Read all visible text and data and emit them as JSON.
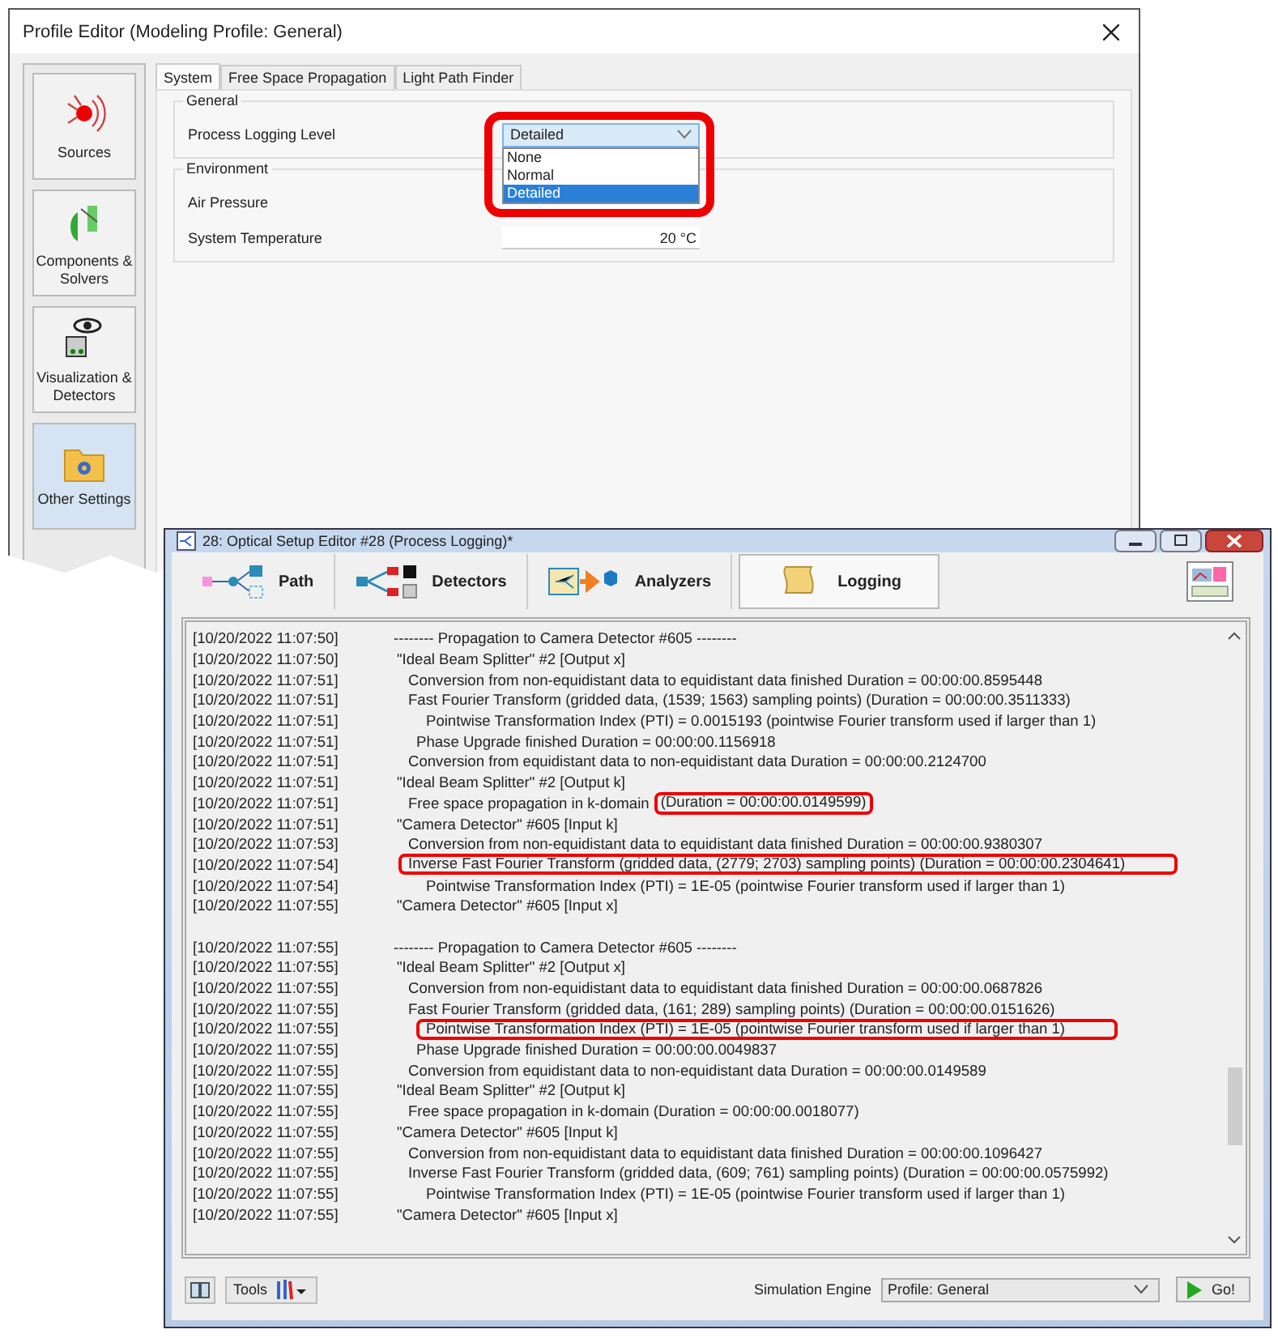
{
  "profile_editor": {
    "title": "Profile Editor (Modeling Profile: General)",
    "categories": [
      {
        "label": "Sources",
        "kind": "sources",
        "selected": false
      },
      {
        "label": "Components & Solvers",
        "kind": "components",
        "selected": false
      },
      {
        "label": "Visualization & Detectors",
        "kind": "visualization",
        "selected": false
      },
      {
        "label": "Other Settings",
        "kind": "settings",
        "selected": true
      }
    ],
    "tabs": [
      {
        "label": "System",
        "selected": true
      },
      {
        "label": "Free Space Propagation",
        "selected": false
      },
      {
        "label": "Light Path Finder",
        "selected": false
      }
    ],
    "groups": [
      {
        "title": "General",
        "fields": [
          {
            "label": "Process Logging Level",
            "kind": "dropdown",
            "value": "Detailed",
            "open": true,
            "highlighted": true,
            "options": [
              {
                "label": "None",
                "selected": false
              },
              {
                "label": "Normal",
                "selected": false
              },
              {
                "label": "Detailed",
                "selected": true
              }
            ]
          }
        ]
      },
      {
        "title": "Environment",
        "fields": [
          {
            "label": "Air Pressure",
            "kind": "number"
          },
          {
            "label": "System Temperature",
            "kind": "number",
            "value": "20 °C"
          }
        ]
      }
    ]
  },
  "setup_editor": {
    "title": "28: Optical Setup Editor #28 (Process Logging)*",
    "tabs": [
      {
        "label": "Path",
        "kind": "path",
        "selected": false
      },
      {
        "label": "Detectors",
        "kind": "detectors",
        "selected": false
      },
      {
        "label": "Analyzers",
        "kind": "analyzers",
        "selected": false
      },
      {
        "label": "Logging",
        "kind": "logging",
        "selected": true
      }
    ],
    "log": {
      "groups": [
        {
          "lines": [
            {
              "time": "[10/20/2022 11:07:50]",
              "kind": "section",
              "text": "-------- Propagation to Camera Detector #605 --------"
            },
            {
              "time": "[10/20/2022 11:07:50]",
              "kind": "element",
              "text": "\"Ideal Beam Splitter\" #2 [Output x]"
            },
            {
              "time": "[10/20/2022 11:07:51]",
              "kind": "step",
              "text": "Conversion from non-equidistant data to equidistant data finished Duration = 00:00:00.8595448"
            },
            {
              "time": "[10/20/2022 11:07:51]",
              "kind": "step",
              "text": "Fast Fourier Transform (gridded data, (1539; 1563) sampling points) (Duration = 00:00:00.3511333)"
            },
            {
              "time": "[10/20/2022 11:07:51]",
              "kind": "index",
              "text": "Pointwise Transformation Index (PTI) = 0.0015193 (pointwise Fourier transform used if larger than 1)"
            },
            {
              "time": "[10/20/2022 11:07:51]",
              "kind": "phase",
              "text": "Phase Upgrade finished Duration = 00:00:00.1156918"
            },
            {
              "time": "[10/20/2022 11:07:51]",
              "kind": "step",
              "text": "Conversion from equidistant data to non-equidistant data  Duration = 00:00:00.2124700"
            },
            {
              "time": "[10/20/2022 11:07:51]",
              "kind": "element",
              "text": "\"Ideal Beam Splitter\" #2 [Output k]"
            },
            {
              "time": "[10/20/2022 11:07:51]",
              "kind": "step",
              "text": "Free space propagation in k-domain",
              "boxed": "(Duration = 00:00:00.0149599)"
            },
            {
              "time": "[10/20/2022 11:07:51]",
              "kind": "element",
              "text": "\"Camera Detector\" #605 [Input k]"
            },
            {
              "time": "[10/20/2022 11:07:53]",
              "kind": "step",
              "text": "Conversion from non-equidistant data to equidistant data finished Duration = 00:00:00.9380307"
            },
            {
              "time": "[10/20/2022 11:07:54]",
              "kind": "step",
              "boxed": "Inverse Fast Fourier Transform (gridded data, (2779; 2703) sampling points) (Duration = 00:00:00.2304641)"
            },
            {
              "time": "[10/20/2022 11:07:54]",
              "kind": "index",
              "text": "Pointwise Transformation Index (PTI) = 1E-05 (pointwise Fourier transform used if larger than 1)"
            },
            {
              "time": "[10/20/2022 11:07:55]",
              "kind": "element",
              "text": "\"Camera Detector\" #605 [Input x]"
            }
          ]
        },
        {
          "lines": [
            {
              "time": "[10/20/2022 11:07:55]",
              "kind": "section",
              "text": "-------- Propagation to Camera Detector #605 --------"
            },
            {
              "time": "[10/20/2022 11:07:55]",
              "kind": "element",
              "text": "\"Ideal Beam Splitter\" #2 [Output x]"
            },
            {
              "time": "[10/20/2022 11:07:55]",
              "kind": "step",
              "text": "Conversion from non-equidistant data to equidistant data finished Duration = 00:00:00.0687826"
            },
            {
              "time": "[10/20/2022 11:07:55]",
              "kind": "step",
              "text": "Fast Fourier Transform (gridded data, (161; 289) sampling points) (Duration = 00:00:00.0151626)"
            },
            {
              "time": "[10/20/2022 11:07:55]",
              "kind": "index",
              "boxed": "Pointwise Transformation Index (PTI) = 1E-05 (pointwise Fourier transform used if larger than 1)"
            },
            {
              "time": "[10/20/2022 11:07:55]",
              "kind": "phase",
              "text": "Phase Upgrade finished Duration = 00:00:00.0049837"
            },
            {
              "time": "[10/20/2022 11:07:55]",
              "kind": "step",
              "text": "Conversion from equidistant data to non-equidistant data  Duration = 00:00:00.0149589"
            },
            {
              "time": "[10/20/2022 11:07:55]",
              "kind": "element",
              "text": "\"Ideal Beam Splitter\" #2 [Output k]"
            },
            {
              "time": "[10/20/2022 11:07:55]",
              "kind": "step",
              "text": "Free space propagation in k-domain (Duration = 00:00:00.0018077)"
            },
            {
              "time": "[10/20/2022 11:07:55]",
              "kind": "element",
              "text": "\"Camera Detector\" #605 [Input k]"
            },
            {
              "time": "[10/20/2022 11:07:55]",
              "kind": "step",
              "text": "Conversion from non-equidistant data to equidistant data finished Duration = 00:00:00.1096427"
            },
            {
              "time": "[10/20/2022 11:07:55]",
              "kind": "step",
              "text": "Inverse Fast Fourier Transform (gridded data, (609; 761) sampling points) (Duration = 00:00:00.0575992)"
            },
            {
              "time": "[10/20/2022 11:07:55]",
              "kind": "index",
              "text": "Pointwise Transformation Index (PTI) = 1E-05 (pointwise Fourier transform used if larger than 1)"
            },
            {
              "time": "[10/20/2022 11:07:55]",
              "kind": "element",
              "text": "\"Camera Detector\" #605 [Input x]"
            }
          ]
        }
      ]
    },
    "tools_label": "Tools",
    "engine_label": "Simulation Engine",
    "engine_value": "Profile: General",
    "go_label": "Go!"
  }
}
